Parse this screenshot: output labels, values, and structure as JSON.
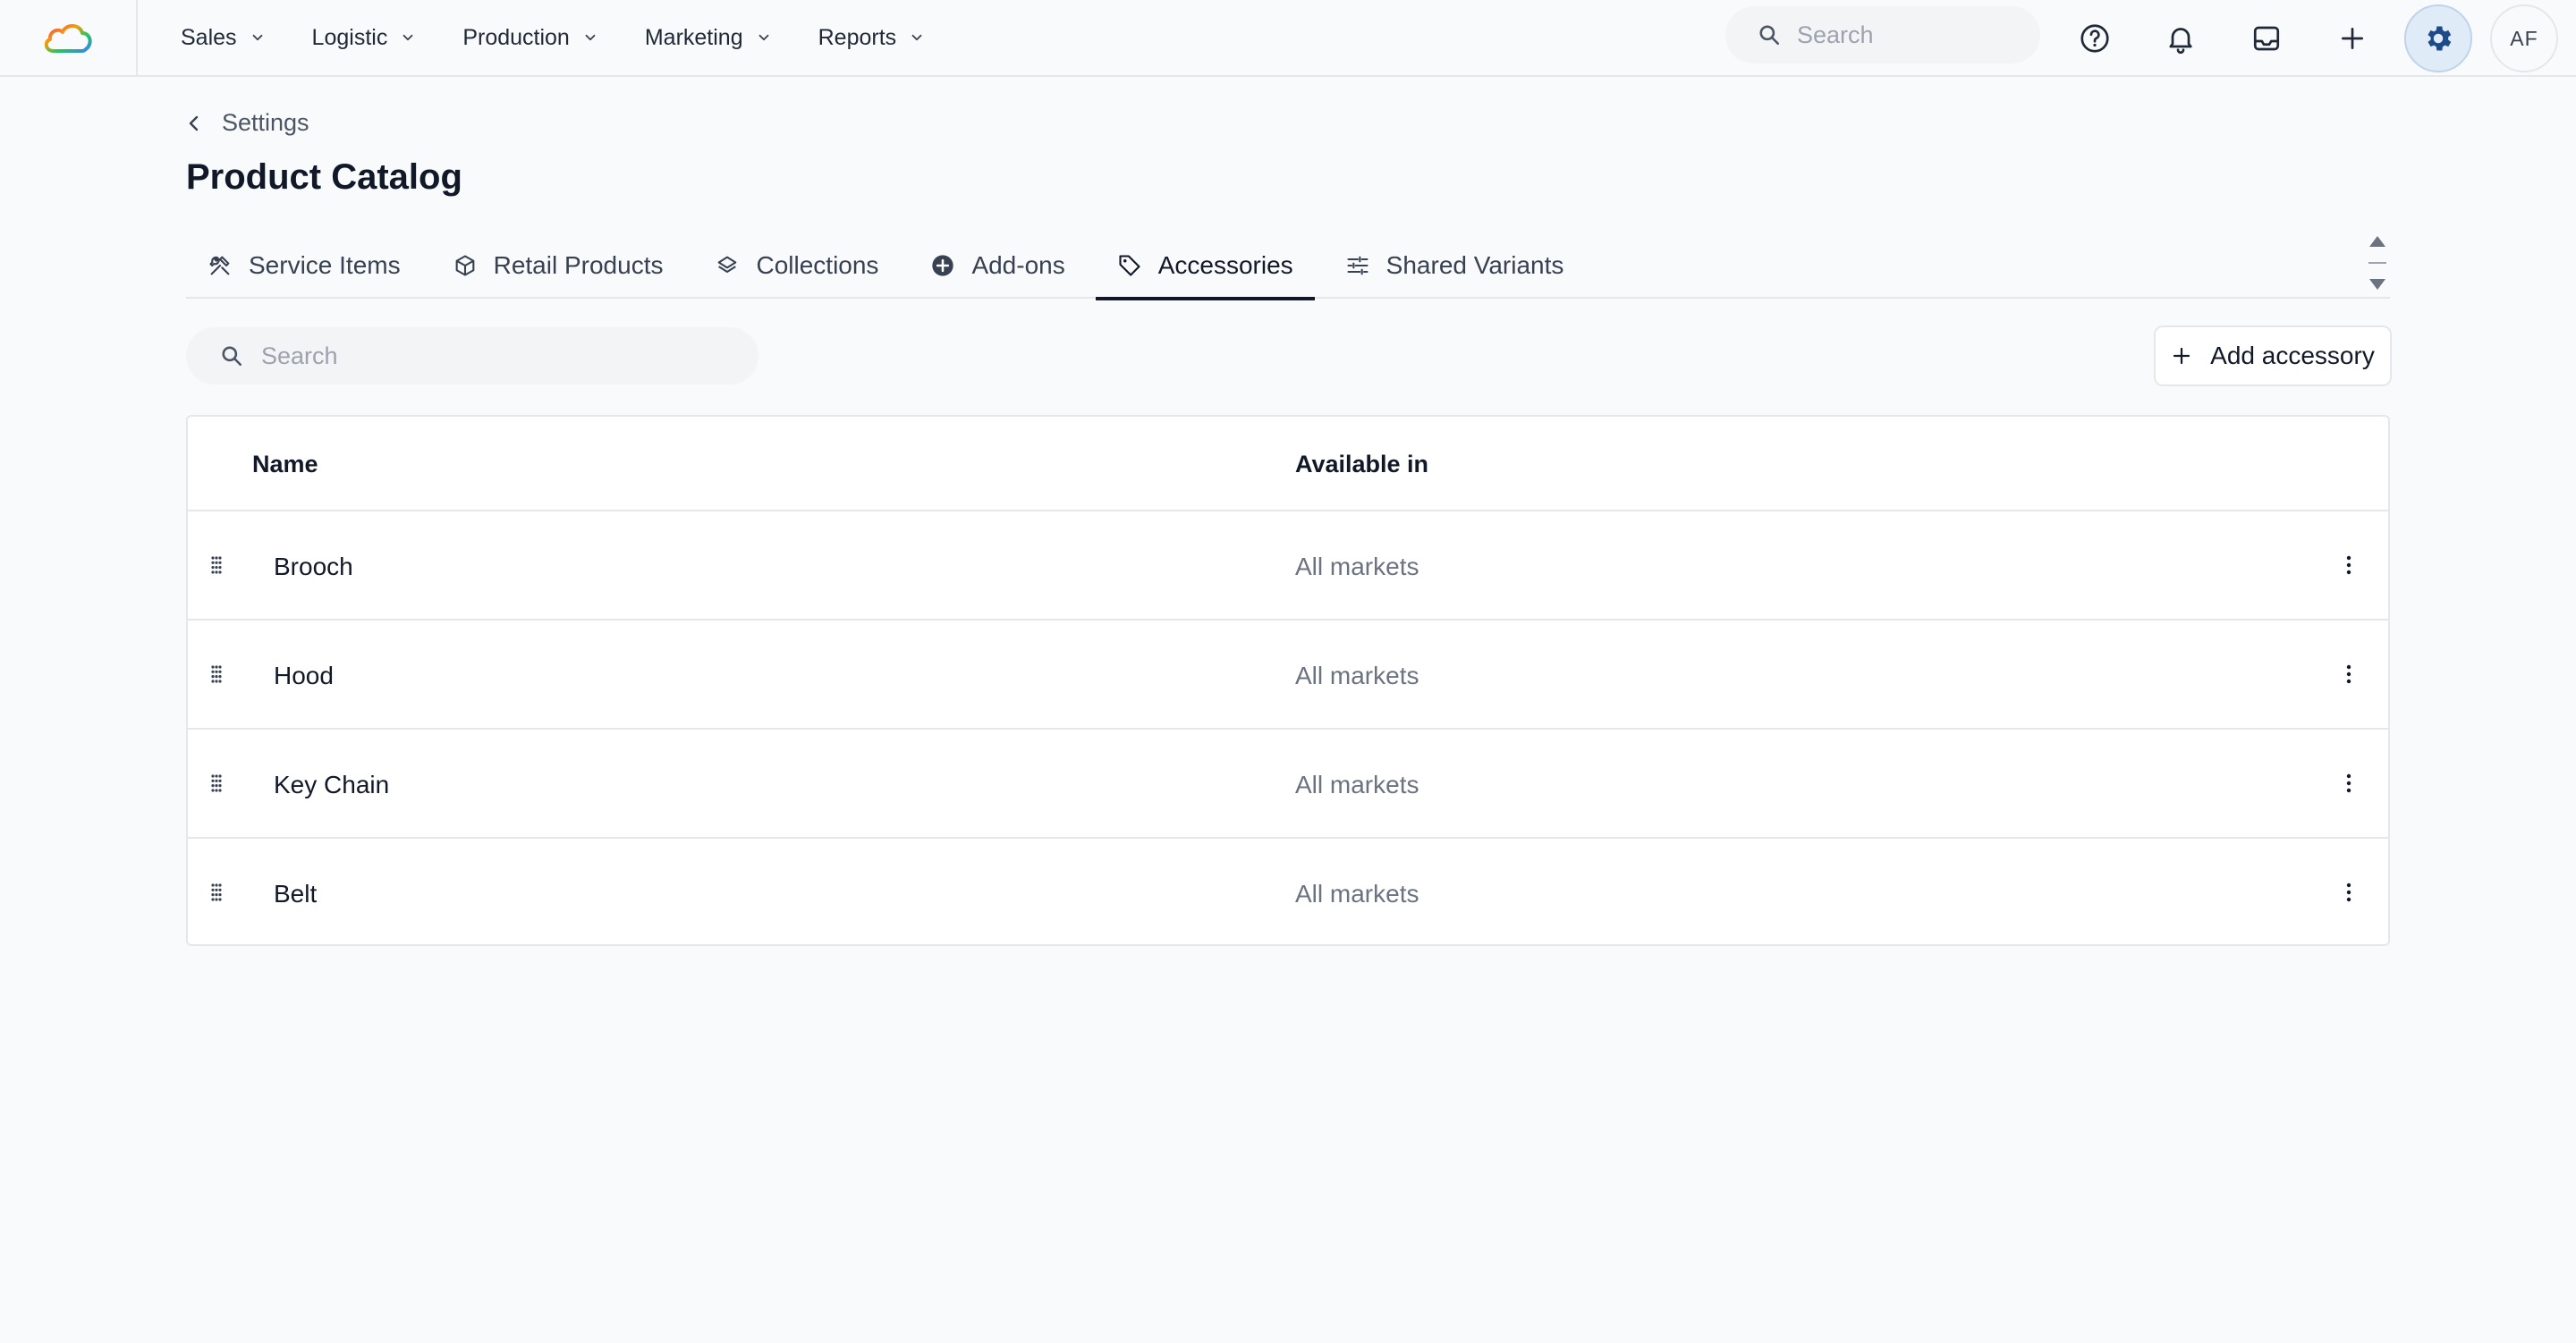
{
  "nav": {
    "items": [
      {
        "label": "Sales"
      },
      {
        "label": "Logistic"
      },
      {
        "label": "Production"
      },
      {
        "label": "Marketing"
      },
      {
        "label": "Reports"
      }
    ],
    "search_placeholder": "Search",
    "user_initials": "AF"
  },
  "header": {
    "breadcrumb": "Settings",
    "title": "Product Catalog"
  },
  "tabs": [
    {
      "label": "Service Items",
      "icon": "hammer-wrench-icon"
    },
    {
      "label": "Retail Products",
      "icon": "cube-icon"
    },
    {
      "label": "Collections",
      "icon": "layers-icon"
    },
    {
      "label": "Add-ons",
      "icon": "plus-circle-icon"
    },
    {
      "label": "Accessories",
      "icon": "tag-icon",
      "active": true
    },
    {
      "label": "Shared Variants",
      "icon": "sliders-icon"
    }
  ],
  "toolbar": {
    "search_placeholder": "Search",
    "add_label": "Add accessory"
  },
  "table": {
    "columns": [
      "Name",
      "Available in"
    ],
    "rows": [
      {
        "name": "Brooch",
        "available": "All markets"
      },
      {
        "name": "Hood",
        "available": "All markets"
      },
      {
        "name": "Key Chain",
        "available": "All markets"
      },
      {
        "name": "Belt",
        "available": "All markets"
      }
    ]
  },
  "colors": {
    "background": "#f9fafb",
    "accent": "#1e4a8a",
    "border": "#e5e7eb",
    "muted_text": "#6b7280"
  }
}
